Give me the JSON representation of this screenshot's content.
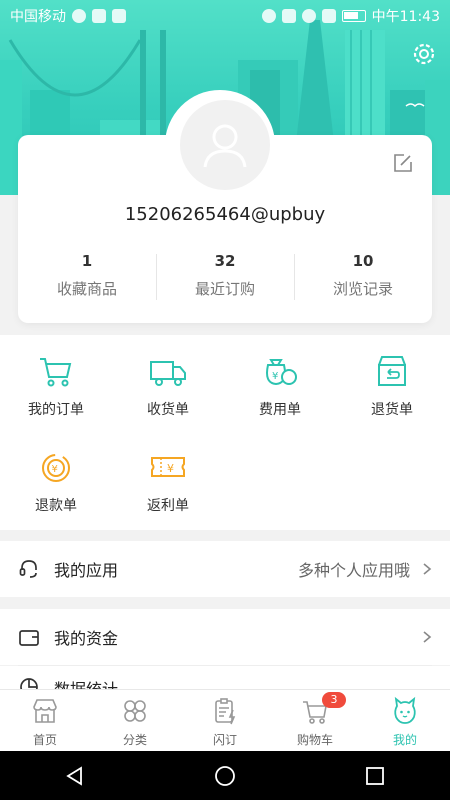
{
  "status_bar": {
    "carrier": "中国移动",
    "time": "中午11:43"
  },
  "profile": {
    "email": "15206265464@upbuy",
    "stats": [
      {
        "value": "1",
        "label": "收藏商品"
      },
      {
        "value": "32",
        "label": "最近订购"
      },
      {
        "value": "10",
        "label": "浏览记录"
      }
    ]
  },
  "grid": {
    "items": [
      {
        "label": "我的订单",
        "icon": "cart-icon"
      },
      {
        "label": "收货单",
        "icon": "truck-icon"
      },
      {
        "label": "费用单",
        "icon": "money-bag-icon"
      },
      {
        "label": "退货单",
        "icon": "return-box-icon"
      },
      {
        "label": "退款单",
        "icon": "refund-coin-icon"
      },
      {
        "label": "返利单",
        "icon": "rebate-ticket-icon"
      }
    ]
  },
  "menu": {
    "apps": {
      "label": "我的应用",
      "hint": "多种个人应用哦"
    },
    "funds": {
      "label": "我的资金"
    },
    "stats": {
      "label": "数据统计"
    }
  },
  "tabbar": {
    "items": [
      {
        "label": "首页",
        "icon": "store-icon"
      },
      {
        "label": "分类",
        "icon": "category-icon"
      },
      {
        "label": "闪订",
        "icon": "quick-order-icon"
      },
      {
        "label": "购物车",
        "icon": "cart-icon"
      },
      {
        "label": "我的",
        "icon": "profile-icon"
      }
    ],
    "cart_badge": "3",
    "active": "我的"
  },
  "colors": {
    "accent": "#2cc3b0",
    "orange": "#f5a623",
    "badge": "#f04b3c"
  }
}
